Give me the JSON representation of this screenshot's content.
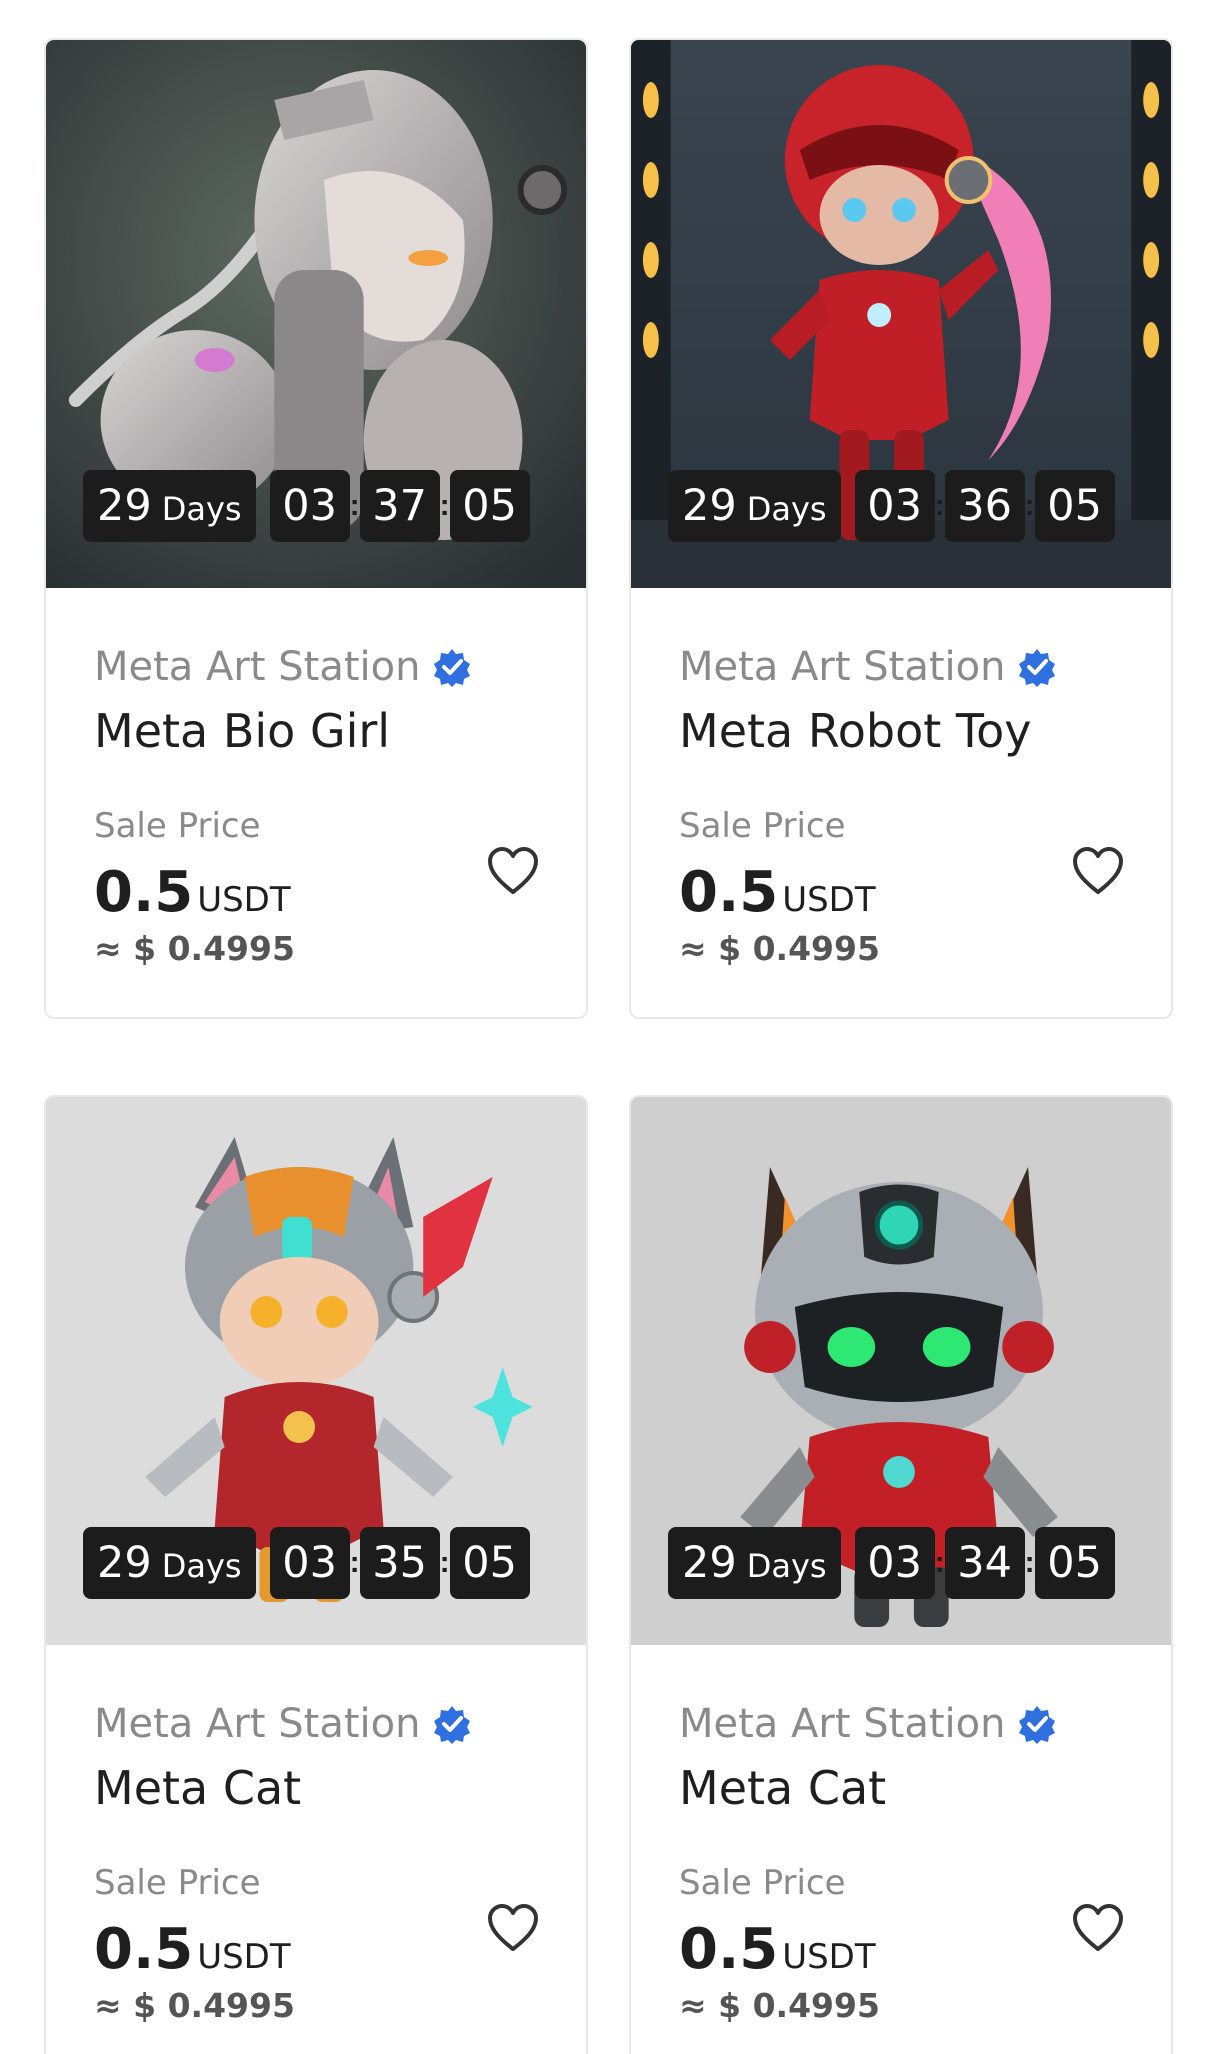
{
  "cards": [
    {
      "creator": "Meta Art Station",
      "title": "Meta Bio Girl",
      "timer": {
        "days": "29",
        "days_unit": "Days",
        "hours": "03",
        "minutes": "37",
        "seconds": "05"
      },
      "sale_label": "Sale Price",
      "price": "0.5",
      "currency": "USDT",
      "usd": "≈ $ 0.4995",
      "artwork_icon": "bio-girl-artwork"
    },
    {
      "creator": "Meta Art Station",
      "title": "Meta Robot Toy",
      "timer": {
        "days": "29",
        "days_unit": "Days",
        "hours": "03",
        "minutes": "36",
        "seconds": "05"
      },
      "sale_label": "Sale Price",
      "price": "0.5",
      "currency": "USDT",
      "usd": "≈ $ 0.4995",
      "artwork_icon": "robot-toy-artwork"
    },
    {
      "creator": "Meta Art Station",
      "title": "Meta Cat",
      "timer": {
        "days": "29",
        "days_unit": "Days",
        "hours": "03",
        "minutes": "35",
        "seconds": "05"
      },
      "sale_label": "Sale Price",
      "price": "0.5",
      "currency": "USDT",
      "usd": "≈ $ 0.4995",
      "artwork_icon": "cat-girl-artwork"
    },
    {
      "creator": "Meta Art Station",
      "title": "Meta Cat",
      "timer": {
        "days": "29",
        "days_unit": "Days",
        "hours": "03",
        "minutes": "34",
        "seconds": "05"
      },
      "sale_label": "Sale Price",
      "price": "0.5",
      "currency": "USDT",
      "usd": "≈ $ 0.4995",
      "artwork_icon": "robot-cat-artwork"
    }
  ],
  "colors": {
    "verified_badge": "#2f6fe0",
    "timer_bg": "#1c1c1c",
    "muted_text": "#8a8a8a",
    "card_border": "#e8e8e8"
  }
}
